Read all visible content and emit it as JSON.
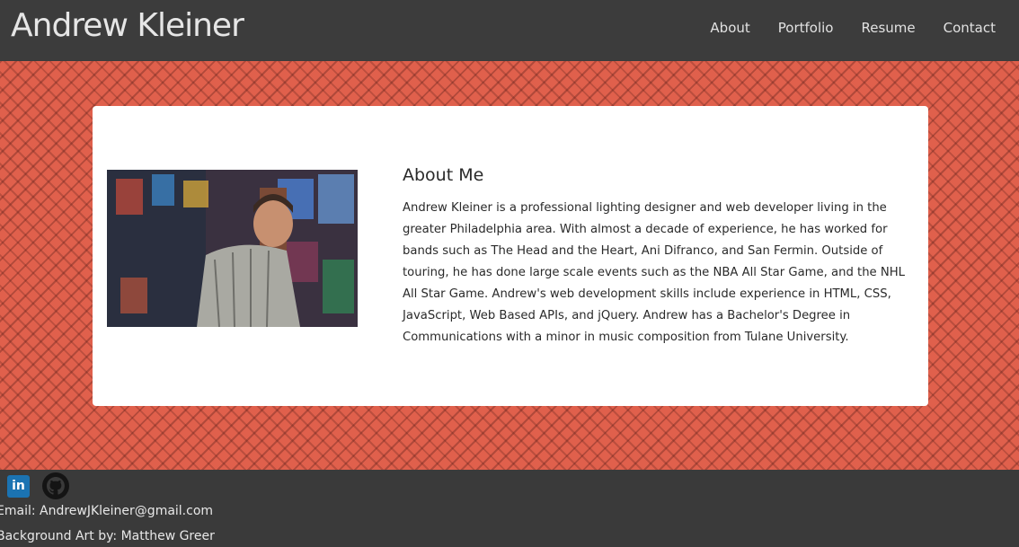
{
  "header": {
    "brand": "Andrew Kleiner",
    "nav": [
      {
        "label": "About"
      },
      {
        "label": "Portfolio"
      },
      {
        "label": "Resume"
      },
      {
        "label": "Contact"
      }
    ]
  },
  "about": {
    "heading": "About Me",
    "body": "Andrew Kleiner is a professional lighting designer and web developer living in the greater Philadelphia area. With almost a decade of experience, he has worked for bands such as The Head and the Heart, Ani Difranco, and San Fermin. Outside of touring, he has done large scale events such as the NBA All Star Game, and the NHL All Star Game. Andrew's web development skills include experience in HTML, CSS, JavaScript, Web Based APIs, and jQuery. Andrew has a Bachelor's Degree in Communications with a minor in music composition from Tulane University."
  },
  "footer": {
    "linkedin_glyph": "in",
    "email": "Email: AndrewJKleiner@gmail.com",
    "art_credit": "Background Art by: Matthew Greer"
  },
  "colors": {
    "header_bg": "#3c3c3c",
    "hero_bg": "#e0604c",
    "linkedin": "#1b73b2"
  }
}
